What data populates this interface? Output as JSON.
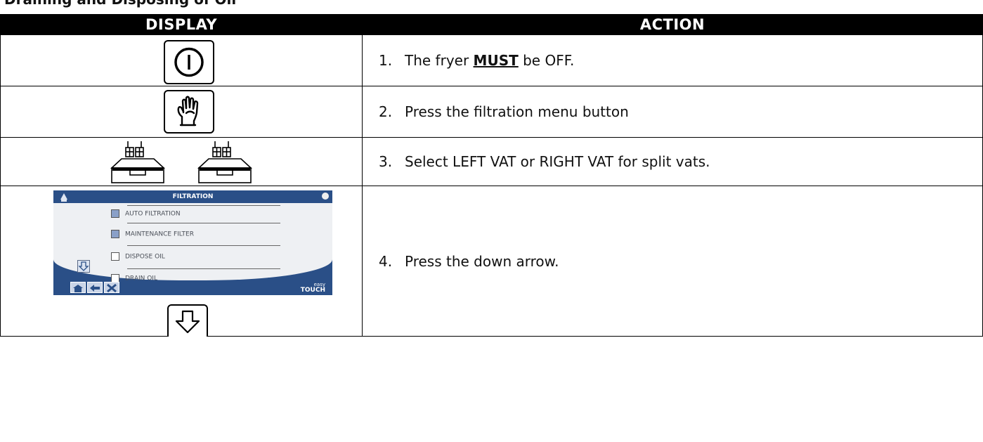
{
  "header_strip": {
    "text": "Draining and Disposing of Oil"
  },
  "table": {
    "headers": {
      "display": "DISPLAY",
      "action": "ACTION"
    },
    "rows": [
      {
        "num": "1.",
        "pre": "The fryer ",
        "strong": "MUST",
        "post": " be OFF.",
        "display_icon": "power-icon"
      },
      {
        "num": "2.",
        "text": "Press the filtration menu button",
        "display_icon": "filter-hand-icon"
      },
      {
        "num": "3.",
        "text": "Select LEFT VAT or RIGHT VAT for split vats.",
        "display_icon": "split-vat-icons"
      },
      {
        "num": "4.",
        "text": "Press the down arrow.",
        "display_icon": "down-arrow-icon"
      }
    ]
  },
  "screen": {
    "title": "FILTRATION",
    "items": [
      {
        "label": "AUTO FILTRATION",
        "checked": true
      },
      {
        "label": "MAINTENANCE FILTER",
        "checked": true
      },
      {
        "label": "DISPOSE OIL",
        "checked": false
      },
      {
        "label": "DRAIN OIL",
        "checked": false
      }
    ],
    "logo_top": "easy",
    "logo_bottom": "TOUCH"
  },
  "colors": {
    "screen_blue": "#2a4f87",
    "screen_panel": "#eef0f3",
    "header_bg": "#000000"
  }
}
